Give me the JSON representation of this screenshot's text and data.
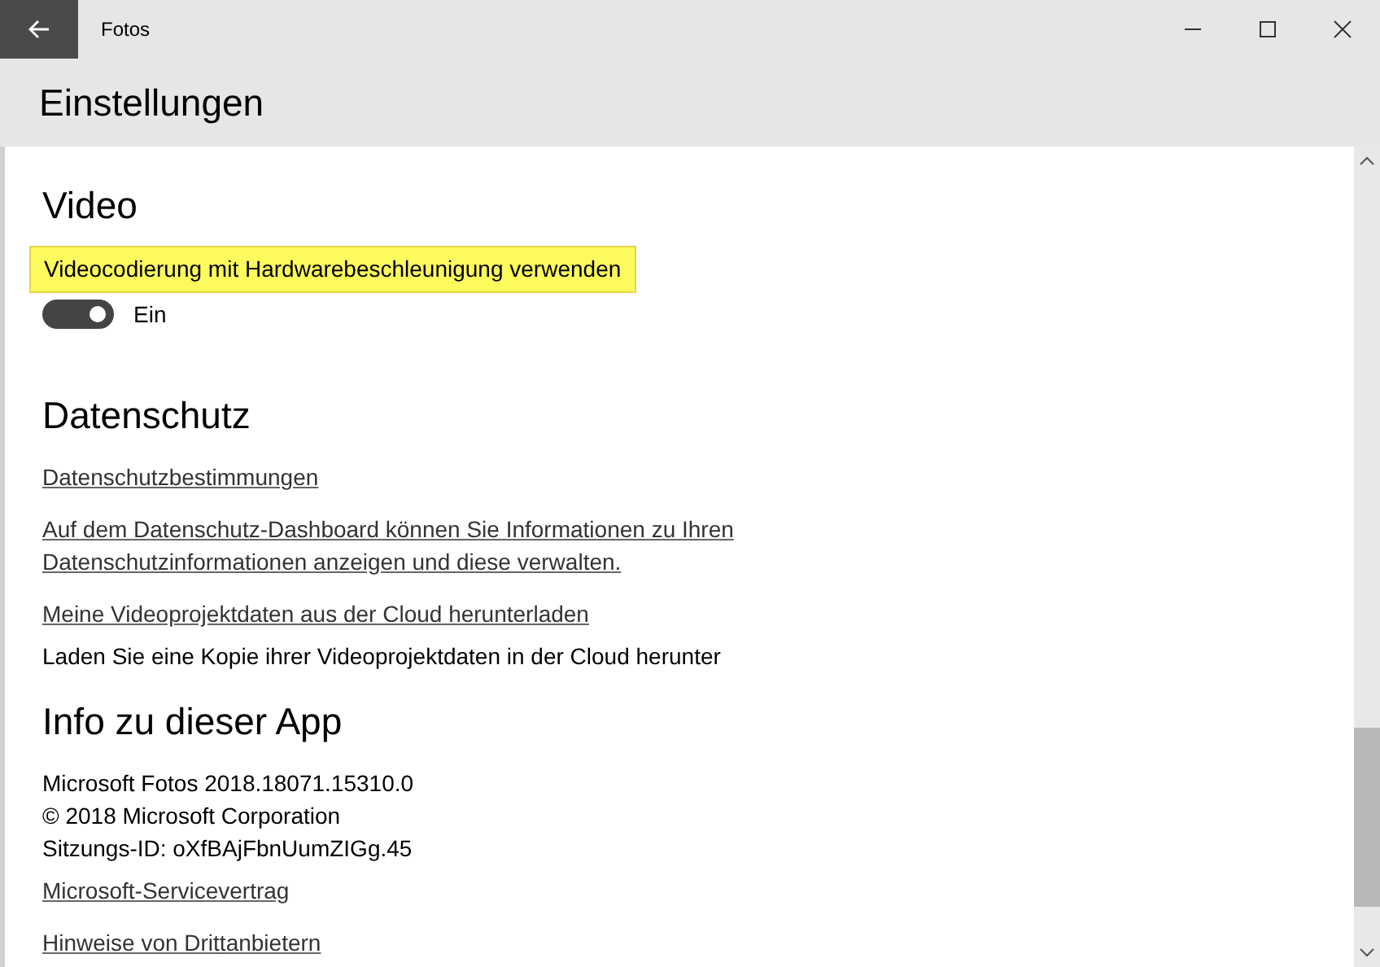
{
  "window": {
    "title": "Fotos"
  },
  "page": {
    "title": "Einstellungen"
  },
  "sections": [
    {
      "heading": "Video",
      "items": [
        {
          "kind": "toggle",
          "label": "Videocodierung mit Hardwarebeschleunigung verwenden",
          "highlighted": true,
          "on": true,
          "state_label": "Ein"
        }
      ]
    },
    {
      "heading": "Datenschutz",
      "items": [
        {
          "kind": "link",
          "lines": [
            "Datenschutzbestimmungen"
          ]
        },
        {
          "kind": "link",
          "lines": [
            "Auf dem Datenschutz-Dashboard können Sie Informationen zu Ihren",
            "Datenschutzinformationen anzeigen und diese verwalten."
          ]
        },
        {
          "kind": "link",
          "lines": [
            "Meine Videoprojektdaten aus der Cloud herunterladen"
          ]
        },
        {
          "kind": "text",
          "lines": [
            "Laden Sie eine Kopie ihrer Videoprojektdaten in der Cloud herunter"
          ]
        }
      ]
    },
    {
      "heading": "Info zu dieser App",
      "items": [
        {
          "kind": "text",
          "lines": [
            "Microsoft Fotos 2018.18071.15310.0"
          ]
        },
        {
          "kind": "text",
          "lines": [
            "© 2018 Microsoft Corporation"
          ]
        },
        {
          "kind": "text",
          "lines": [
            "Sitzungs-ID: oXfBAjFbnUumZIGg.45"
          ]
        },
        {
          "kind": "link",
          "lines": [
            "Microsoft-Servicevertrag"
          ]
        },
        {
          "kind": "link",
          "lines": [
            "Hinweise von Drittanbietern"
          ]
        }
      ]
    }
  ]
}
